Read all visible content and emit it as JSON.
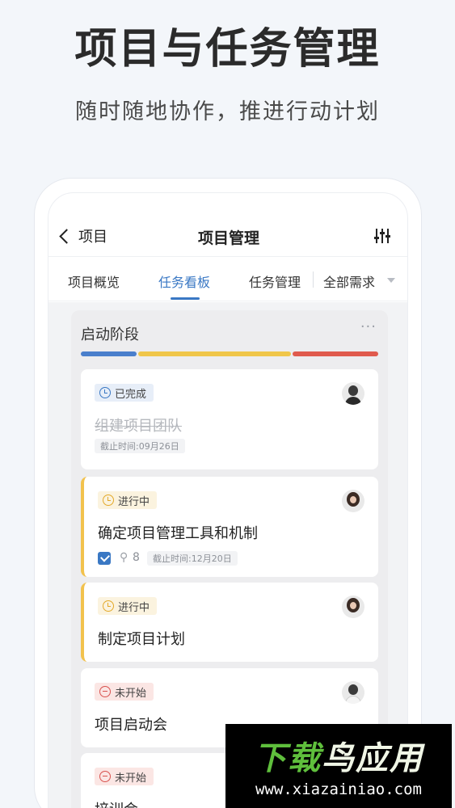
{
  "hero": {
    "title": "项目与任务管理",
    "subtitle": "随时随地协作，推进行动计划"
  },
  "nav": {
    "back_label": "项目",
    "title": "项目管理",
    "filter_icon": "sliders-icon"
  },
  "tabs": [
    {
      "label": "项目概览",
      "active": false
    },
    {
      "label": "任务看板",
      "active": true
    },
    {
      "label": "任务管理",
      "active": false
    },
    {
      "label": "全部需求",
      "active": false
    }
  ],
  "column": {
    "title": "启动阶段",
    "more_label": "···",
    "progress_colors": [
      "#4a7fcc",
      "#f0c64a",
      "#e05a4d"
    ],
    "progress_shares": [
      0.19,
      0.52,
      0.29
    ],
    "cards": [
      {
        "status": "已完成",
        "status_type": "done",
        "title": "组建项目团队",
        "deadline": "截止时间:09月26日"
      },
      {
        "status": "进行中",
        "status_type": "progress",
        "title": "确定项目管理工具和机制",
        "attachments": "8",
        "deadline": "截止时间:12月20日"
      },
      {
        "status": "进行中",
        "status_type": "progress",
        "title": "制定项目计划"
      },
      {
        "status": "未开始",
        "status_type": "todo",
        "title": "项目启动会"
      },
      {
        "status": "未开始",
        "status_type": "todo",
        "title": "培训会"
      }
    ]
  },
  "watermark": {
    "logo_part1": "下载",
    "logo_part2": "鸟应用",
    "url": "www.xiazainiao.com"
  }
}
